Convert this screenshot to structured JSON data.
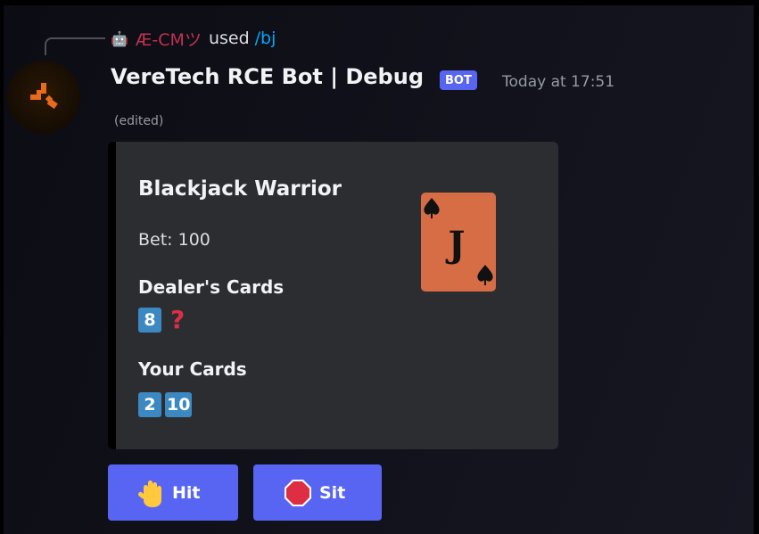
{
  "reply": {
    "avatar_icon": "robot-avatar-icon",
    "user": "Æ-CMツ",
    "used_text": "used",
    "command": "/bj"
  },
  "message": {
    "author": "VereTech RCE Bot | Debug",
    "bot_tag": "BOT",
    "timestamp": "Today at 17:51",
    "edited": "(edited)"
  },
  "embed": {
    "title": "Blackjack Warrior",
    "bet": "Bet: 100",
    "dealer": {
      "label": "Dealer's Cards",
      "cards": [
        "8",
        "?"
      ]
    },
    "player": {
      "label": "Your Cards",
      "cards": [
        "2",
        "10"
      ]
    },
    "thumbnail": {
      "icon": "jack-of-spades-card-icon",
      "rank": "J"
    }
  },
  "buttons": [
    {
      "label": "Hit",
      "icon": "raised-hand-icon"
    },
    {
      "label": "Sit",
      "icon": "stop-sign-icon"
    }
  ],
  "colors": {
    "blurple": "#5865f2",
    "embed_bg": "#2b2d31",
    "keycap_blue": "#3b88c3",
    "card_orange": "#d66d45",
    "reply_user": "#c1314e",
    "command_link": "#00a8fc"
  }
}
